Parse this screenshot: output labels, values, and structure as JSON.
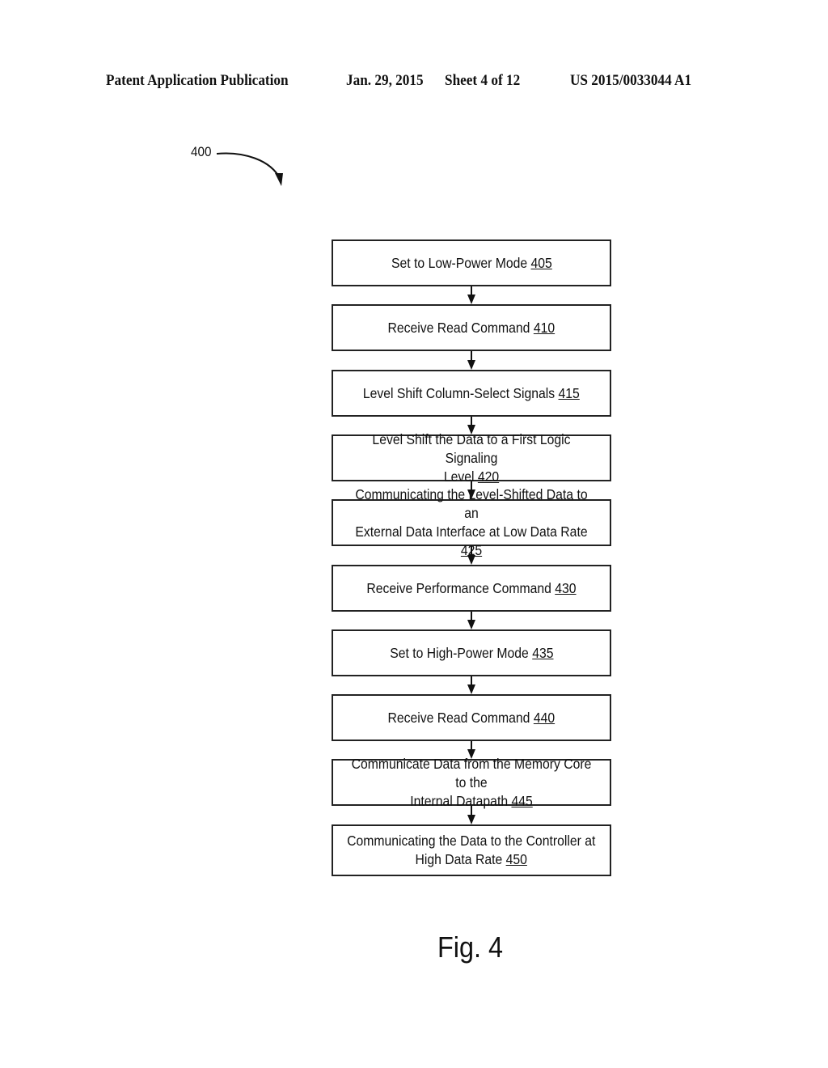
{
  "header": {
    "publication": "Patent Application Publication",
    "date": "Jan. 29, 2015",
    "sheet": "Sheet 4 of 12",
    "number": "US 2015/0033044 A1"
  },
  "diagram": {
    "reference": "400",
    "figure_label": "Fig. 4",
    "steps": [
      {
        "text": "Set to Low-Power Mode",
        "ref": "405"
      },
      {
        "text": "Receive Read Command",
        "ref": "410"
      },
      {
        "text": "Level Shift Column-Select Signals",
        "ref": "415"
      },
      {
        "text": "Level Shift the Data to a First Logic Signaling\nLevel",
        "ref": "420"
      },
      {
        "text": "Communicating the Level-Shifted Data to an\nExternal Data Interface at Low Data Rate",
        "ref": "425"
      },
      {
        "text": "Receive Performance Command",
        "ref": "430"
      },
      {
        "text": "Set to High-Power Mode",
        "ref": "435"
      },
      {
        "text": "Receive Read Command",
        "ref": "440"
      },
      {
        "text": "Communicate Data from the Memory Core to the\nInternal Datapath",
        "ref": "445"
      },
      {
        "text": "Communicating the Data to the Controller at\nHigh Data Rate",
        "ref": "450"
      }
    ]
  }
}
